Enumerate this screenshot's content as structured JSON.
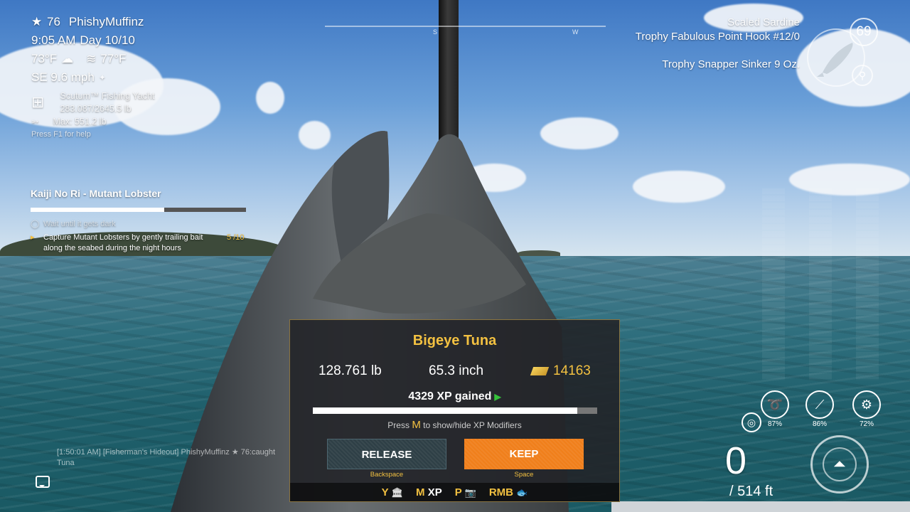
{
  "player": {
    "level": "76",
    "name": "PhishyMuffinz"
  },
  "time": {
    "clock": "9:05 AM",
    "day": "Day 10/10"
  },
  "weather": {
    "air_temp": "73°F",
    "water_temp": "77°F",
    "wind": "SE 9.6 mph"
  },
  "boat": {
    "name": "Scutum™ Fishing Yacht",
    "capacity": "283.087/2645.5 lb",
    "max_fish": "Max: 551.2 lb",
    "help": "Press F1 for help"
  },
  "quest": {
    "title": "Kaiji No Ri - Mutant Lobster",
    "progress": 0.62,
    "objectives": [
      {
        "text": "Wait until it gets dark",
        "count": ""
      },
      {
        "text": "Capture Mutant Lobsters by gently trailing bait along the seabed during the night hours",
        "count": "5 /10"
      }
    ]
  },
  "compass": {
    "markers": [
      "S",
      "W"
    ]
  },
  "tackle": {
    "bait": "Scaled Sardine",
    "hook": "Trophy Fabulous Point Hook #12/0",
    "sinker": "Trophy Snapper Sinker 9 Oz.",
    "lure_level": "69"
  },
  "gear": [
    {
      "icon": "line-icon",
      "pct": "87%"
    },
    {
      "icon": "rod-icon",
      "pct": "86%"
    },
    {
      "icon": "reel-icon",
      "pct": "72%"
    }
  ],
  "depth": {
    "current": "0",
    "total": "/ 514 ft"
  },
  "chat": {
    "message": "[1:50:01 AM] [Fisherman's Hideout] PhishyMuffinz ★ 76:caught Tuna"
  },
  "catch": {
    "fish": "Bigeye Tuna",
    "weight": "128.761 lb",
    "length": "65.3 inch",
    "value": "14163",
    "xp": "4329 XP gained",
    "xp_progress": 0.93,
    "hint_pre": "Press",
    "hint_key": "M",
    "hint_post": "to show/hide XP Modifiers",
    "release_label": "RELEASE",
    "release_key": "Backspace",
    "keep_label": "KEEP",
    "keep_key": "Space",
    "footer": [
      {
        "key": "Y",
        "icon": "🏛"
      },
      {
        "key": "M",
        "icon": "XP"
      },
      {
        "key": "P",
        "icon": "📷"
      },
      {
        "key": "RMB",
        "icon": "🐟"
      }
    ]
  },
  "colors": {
    "accent": "#f3c141",
    "keep": "#f07f1b",
    "release": "#2e3f46"
  }
}
